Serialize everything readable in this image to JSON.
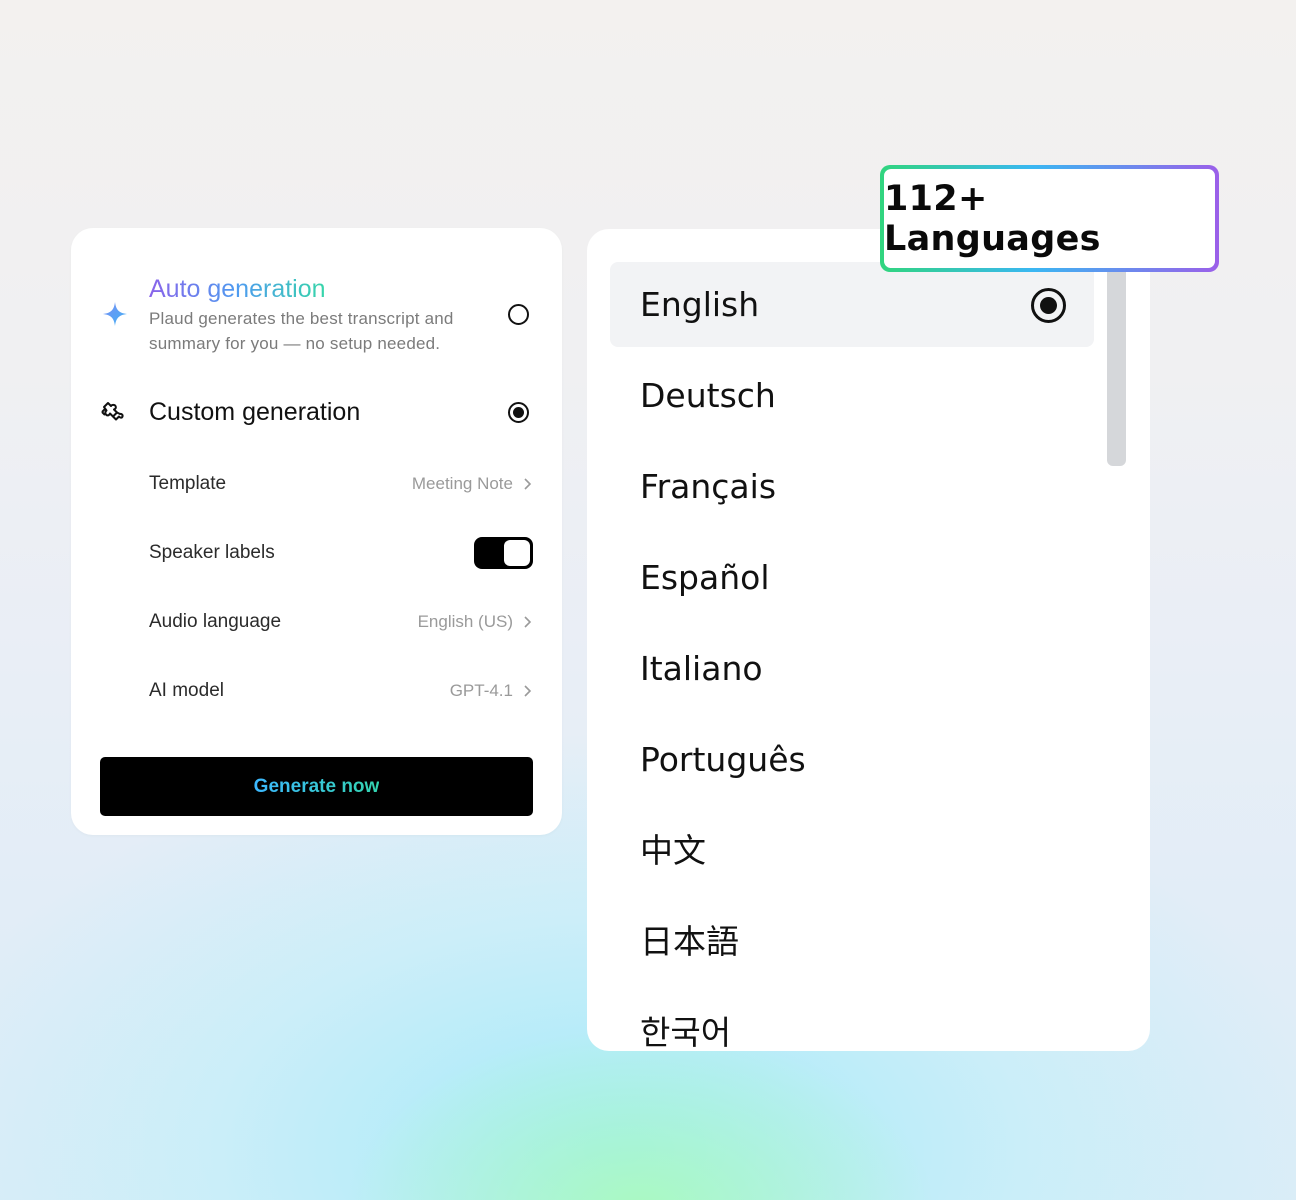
{
  "generation_panel": {
    "auto": {
      "title": "Auto generation",
      "description": "Plaud generates the best transcript and summary for you — no setup needed.",
      "icon": "sparkle-icon",
      "selected": false
    },
    "custom": {
      "title": "Custom generation",
      "icon": "puzzle-icon",
      "selected": true
    },
    "settings": {
      "template": {
        "label": "Template",
        "value": "Meeting Note"
      },
      "speaker_labels": {
        "label": "Speaker labels",
        "enabled": true
      },
      "audio_language": {
        "label": "Audio language",
        "value": "English (US)"
      },
      "ai_model": {
        "label": "AI model",
        "value": "GPT-4.1"
      }
    },
    "generate_button": "Generate now"
  },
  "language_list": {
    "badge": "112+ Languages",
    "selected": "English",
    "items": [
      "English",
      "Deutsch",
      "Français",
      "Español",
      "Italiano",
      "Português",
      "中文",
      "日本語",
      "한국어"
    ]
  },
  "colors": {
    "accent_purple": "#8a63ea",
    "accent_blue": "#4f9bf0",
    "accent_green": "#36d6a9",
    "button_bg": "#000000"
  }
}
